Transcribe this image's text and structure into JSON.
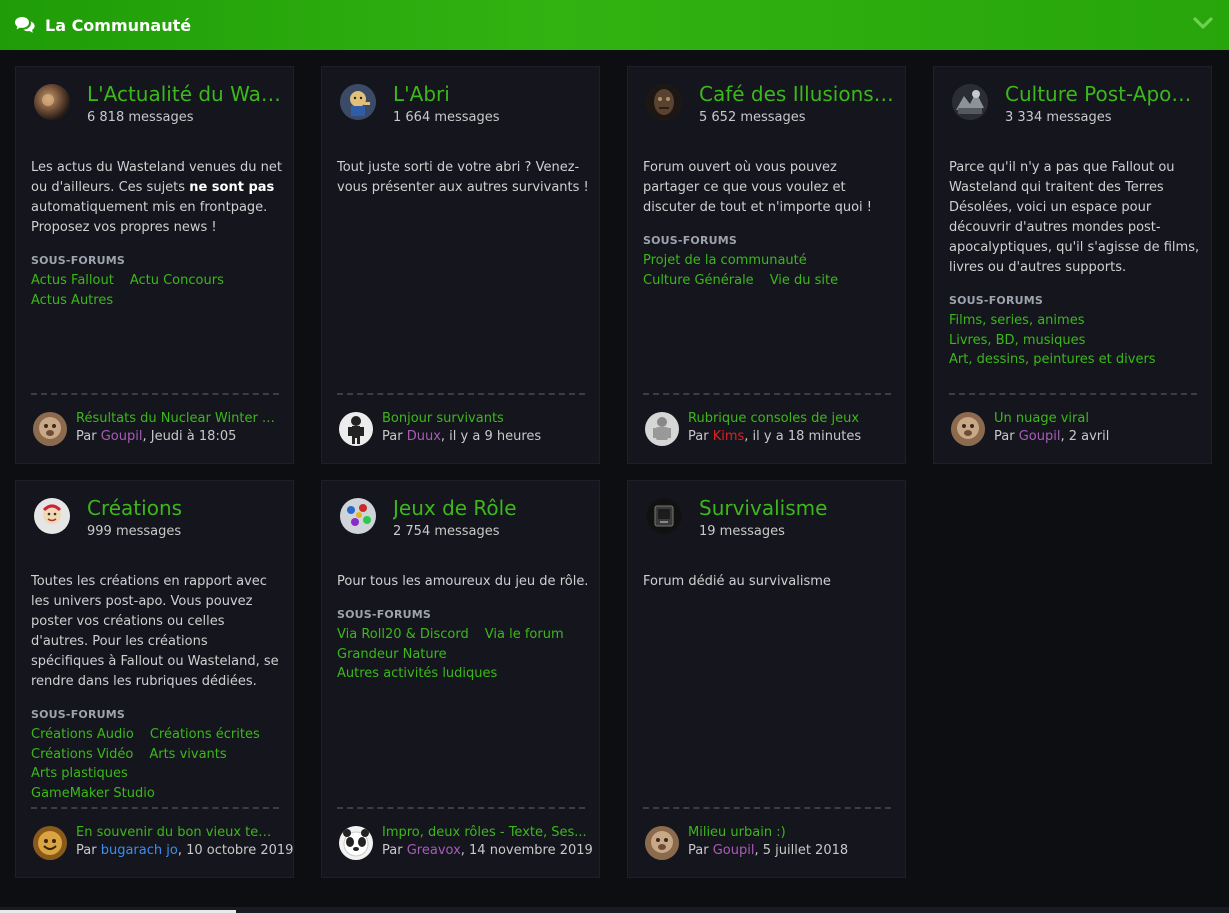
{
  "header": {
    "title": "La Communauté",
    "icon": "comments-icon"
  },
  "sub_heading": "SOUS-FORUMS",
  "by": "Par",
  "forums": [
    {
      "title": "L'Actualité du Wasteland",
      "count": "6 818 messages",
      "desc_parts": [
        "Les actus du Wasteland venues du net ou d'ailleurs. Ces sujets ",
        "ne sont pas",
        " automatiquement mis en frontpage. Proposez vos propres news !"
      ],
      "subforums": [
        "Actus Fallout",
        "Actu Concours",
        "Actus Autres"
      ],
      "last": {
        "title": "Résultats du Nuclear Winter Pr...",
        "user": "Goupil",
        "when": ", Jeudi à 18:05"
      }
    },
    {
      "title": "L'Abri",
      "count": "1 664 messages",
      "desc": "Tout juste sorti de votre abri ? Venez-vous présenter aux autres survivants !",
      "last": {
        "title": "Bonjour survivants",
        "user": "Duux",
        "when": ", il y a 9 heures"
      }
    },
    {
      "title": "Café des Illusions Perdues",
      "count": "5 652 messages",
      "desc": "Forum ouvert où vous pouvez partager ce que vous voulez et discuter de tout et n'importe quoi !",
      "subforums": [
        "Projet de la communauté",
        "Culture Générale",
        "Vie du site"
      ],
      "last": {
        "title": "Rubrique consoles de jeux",
        "user": "Kims",
        "when": ", il y a 18 minutes"
      }
    },
    {
      "title": "Culture Post-Apocalyptique",
      "count": "3 334 messages",
      "desc": "Parce qu'il n'y a pas que Fallout ou Wasteland qui traitent des Terres Désolées, voici un espace pour découvrir d'autres mondes post-apocalyptiques, qu'il s'agisse de films, livres ou d'autres supports.",
      "subforums": [
        "Films, series, animes",
        "Livres, BD, musiques",
        "Art, dessins, peintures et divers"
      ],
      "last": {
        "title": "Un nuage viral",
        "user": "Goupil",
        "when": ", 2 avril"
      }
    },
    {
      "title": "Créations",
      "count": "999 messages",
      "desc": "Toutes les créations en rapport avec les univers post-apo. Vous pouvez poster vos créations ou celles d'autres. Pour les créations spécifiques à Fallout ou Wasteland, se rendre dans les rubriques dédiées.",
      "subforums": [
        "Créations Audio",
        "Créations écrites",
        "Créations Vidéo",
        "Arts vivants",
        "Arts plastiques",
        "GameMaker Studio"
      ],
      "last": {
        "title": "En souvenir du bon vieux temps",
        "user": "bugarach jo",
        "when": ", 10 octobre 2019"
      }
    },
    {
      "title": "Jeux de Rôle",
      "count": "2 754 messages",
      "desc": "Pour tous les amoureux du jeu de rôle.",
      "subforums": [
        "Via Roll20 & Discord",
        "Via le forum",
        "Grandeur Nature",
        "Autres activités ludiques"
      ],
      "last": {
        "title": "Impro, deux rôles - Texte, Ses...",
        "user": "Greavox",
        "when": ", 14 novembre 2019"
      }
    },
    {
      "title": "Survivalisme",
      "count": "19 messages",
      "desc": "Forum dédié au survivalisme",
      "last": {
        "title": "Milieu urbain :)",
        "user": "Goupil",
        "when": ", 5 juillet 2018"
      }
    }
  ],
  "colors": {
    "header_green": "#2aa80d",
    "link_green": "#3cb81a",
    "user_purple": "#a95cb8",
    "user_red": "#e02020",
    "user_blue": "#3c8ef0",
    "background": "#0d0e12",
    "card": "#14151d"
  }
}
